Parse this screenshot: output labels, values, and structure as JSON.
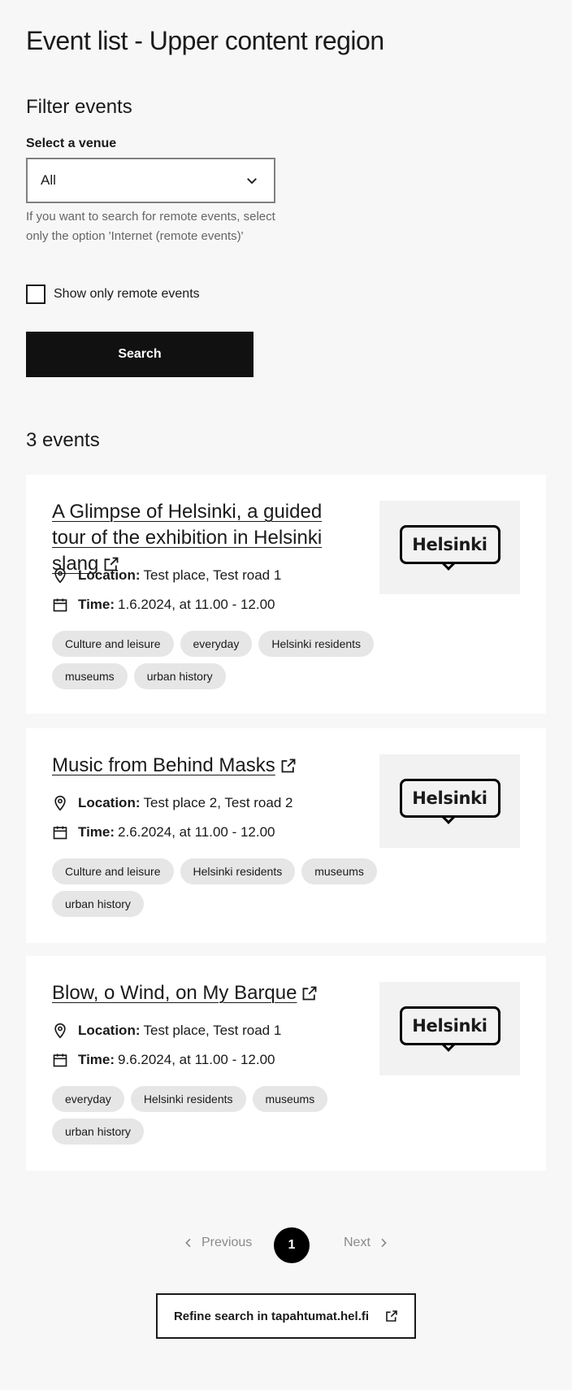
{
  "page": {
    "title": "Event list - Upper content region"
  },
  "filter": {
    "heading": "Filter events",
    "venue_label": "Select a venue",
    "venue_value": "All",
    "help": "If you want to search for remote events, select only the option 'Internet (remote events)'",
    "remote_label": "Show only remote events",
    "search_label": "Search"
  },
  "results": {
    "count_label": "3 events"
  },
  "events": [
    {
      "title": "A Glimpse of Helsinki, a guided tour of the exhibition in Helsinki slang",
      "location_label": "Location:",
      "location": "Test place, Test road 1",
      "time_label": "Time:",
      "time": "1.6.2024, at 11.00 - 12.00",
      "tags": [
        "Culture and leisure",
        "everyday",
        "Helsinki residents",
        "museums",
        "urban history"
      ],
      "logo_text": "Helsinki"
    },
    {
      "title": "Music from Behind Masks",
      "location_label": "Location:",
      "location": "Test place 2, Test road 2",
      "time_label": "Time:",
      "time": "2.6.2024, at 11.00 - 12.00",
      "tags": [
        "Culture and leisure",
        "Helsinki residents",
        "museums",
        "urban history"
      ],
      "logo_text": "Helsinki"
    },
    {
      "title": "Blow, o Wind, on My Barque",
      "location_label": "Location:",
      "location": "Test place, Test road 1",
      "time_label": "Time:",
      "time": "9.6.2024, at 11.00 - 12.00",
      "tags": [
        "everyday",
        "Helsinki residents",
        "museums",
        "urban history"
      ],
      "logo_text": "Helsinki"
    }
  ],
  "pagination": {
    "previous": "Previous",
    "current": "1",
    "next": "Next"
  },
  "refine": {
    "label": "Refine search in tapahtumat.hel.fi"
  }
}
